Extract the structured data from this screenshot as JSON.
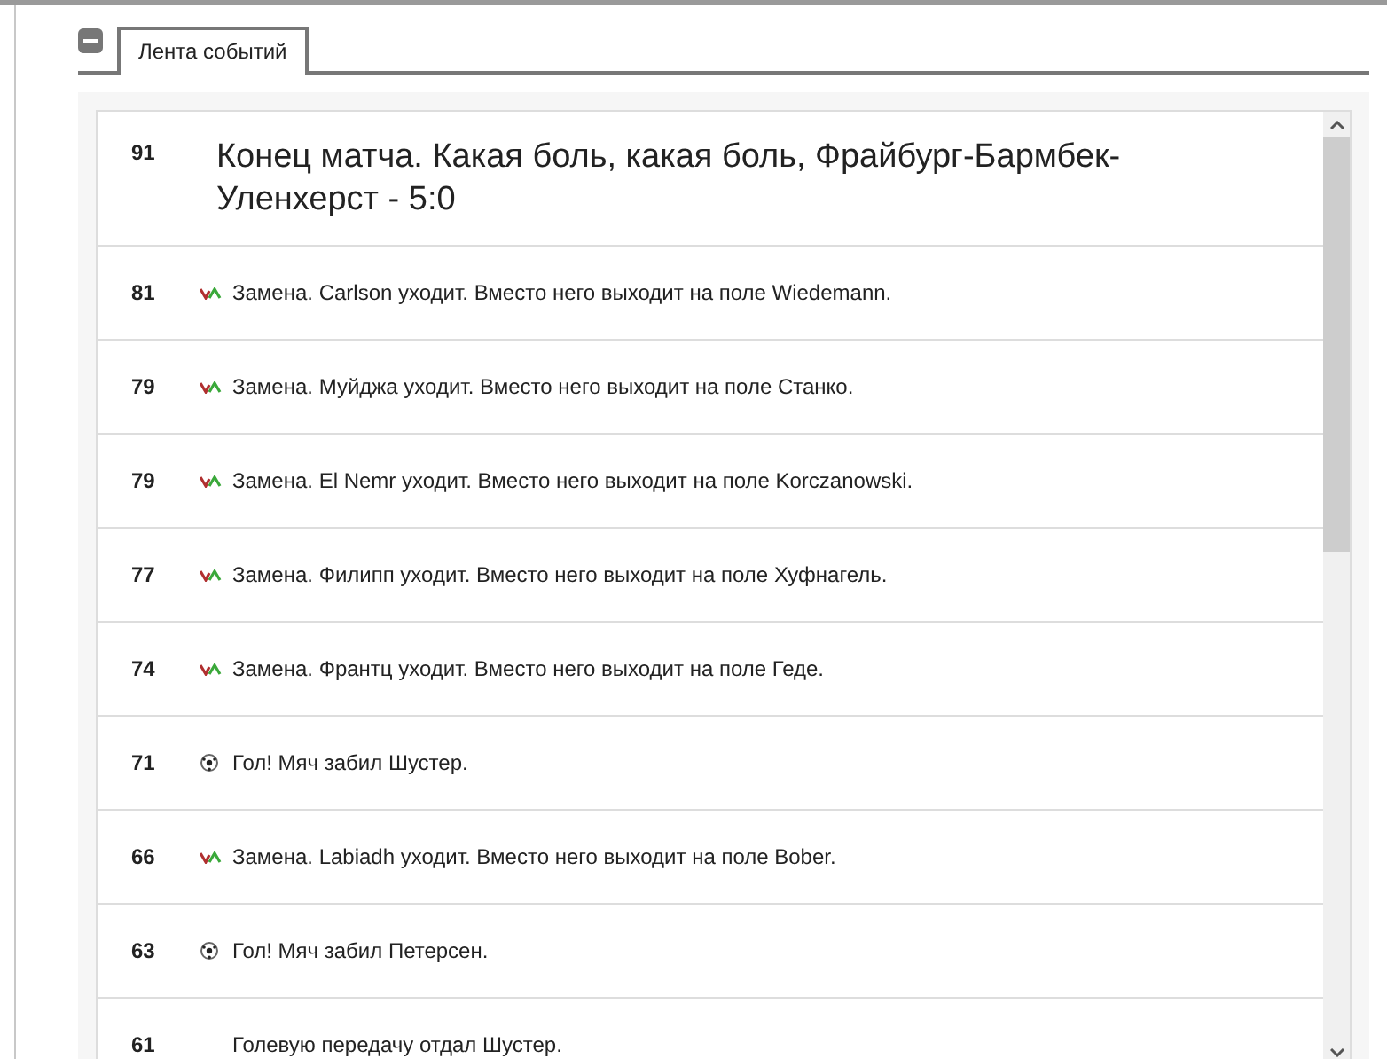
{
  "tabs": [
    {
      "label": "Лента событий",
      "selected": true
    }
  ],
  "events": [
    {
      "minute": "91",
      "kind": "final",
      "text": "Конец матча. Какая боль, какая боль, Фрайбург-Бармбек-Уленхерст - 5:0"
    },
    {
      "minute": "81",
      "kind": "substitution",
      "text": "Замена. Carlson уходит. Вместо него выходит на поле Wiedemann."
    },
    {
      "minute": "79",
      "kind": "substitution",
      "text": "Замена. Муйджа уходит. Вместо него выходит на поле Станко."
    },
    {
      "minute": "79",
      "kind": "substitution",
      "text": "Замена. El Nemr уходит. Вместо него выходит на поле Korczanowski."
    },
    {
      "minute": "77",
      "kind": "substitution",
      "text": "Замена. Филипп уходит. Вместо него выходит на поле Хуфнагель."
    },
    {
      "minute": "74",
      "kind": "substitution",
      "text": "Замена. Франтц уходит. Вместо него выходит на поле Геде."
    },
    {
      "minute": "71",
      "kind": "goal",
      "text": "Гол! Мяч забил Шустер."
    },
    {
      "minute": "66",
      "kind": "substitution",
      "text": "Замена. Labiadh уходит. Вместо него выходит на поле Bober."
    },
    {
      "minute": "63",
      "kind": "goal",
      "text": "Гол! Мяч забил Петерсен."
    },
    {
      "minute": "61",
      "kind": "assist",
      "text": "Голевую передачу отдал Шустер."
    }
  ]
}
